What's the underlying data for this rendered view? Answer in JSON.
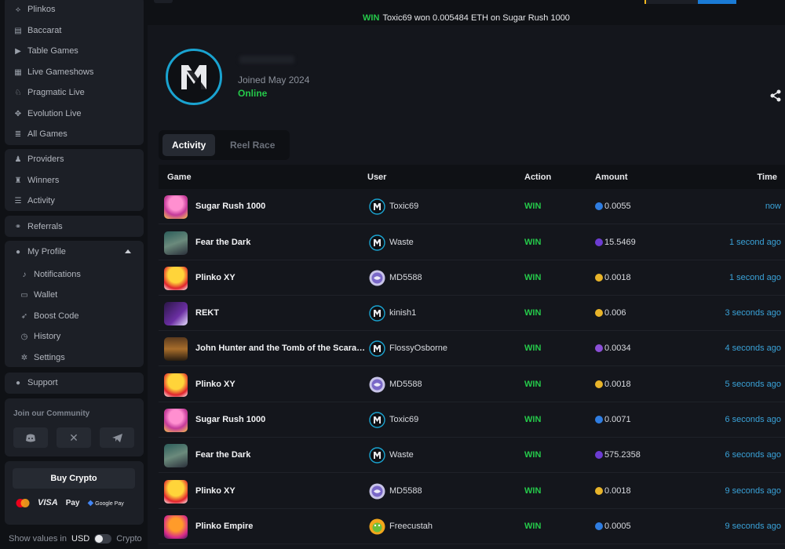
{
  "sidebar": {
    "group1": [
      {
        "label": "Plinkos",
        "icon": "plinko-icon"
      },
      {
        "label": "Baccarat",
        "icon": "cards-icon"
      },
      {
        "label": "Table Games",
        "icon": "table-icon"
      },
      {
        "label": "Live Gameshows",
        "icon": "gift-icon"
      },
      {
        "label": "Pragmatic Live",
        "icon": "dealer-icon"
      },
      {
        "label": "Evolution Live",
        "icon": "gamepad-icon"
      },
      {
        "label": "All Games",
        "icon": "stack-icon"
      }
    ],
    "group2": [
      {
        "label": "Providers",
        "icon": "providers-icon"
      },
      {
        "label": "Winners",
        "icon": "trophy-icon"
      },
      {
        "label": "Activity",
        "icon": "list-icon"
      }
    ],
    "referrals": "Referrals",
    "profile": {
      "label": "My Profile",
      "items": [
        {
          "label": "Notifications",
          "icon": "bell-icon"
        },
        {
          "label": "Wallet",
          "icon": "wallet-icon"
        },
        {
          "label": "Boost Code",
          "icon": "rocket-icon"
        },
        {
          "label": "History",
          "icon": "history-icon"
        },
        {
          "label": "Settings",
          "icon": "gear-icon"
        }
      ]
    },
    "support": "Support",
    "community_title": "Join our Community",
    "buy_crypto": "Buy Crypto",
    "payments": {
      "visa": "VISA",
      "apple_pay": "Pay",
      "google_pay": "Google Pay"
    },
    "show_values": {
      "label": "Show values in",
      "currency": "USD",
      "alt": "Crypto"
    }
  },
  "ticker": {
    "win": "WIN",
    "text": "Toxic69 won 0.005484 ETH on Sugar Rush 1000"
  },
  "profile": {
    "joined": "Joined May 2024",
    "status": "Online"
  },
  "tabs": {
    "active": "Activity",
    "inactive": "Reel Race"
  },
  "table": {
    "headers": {
      "game": "Game",
      "user": "User",
      "action": "Action",
      "amount": "Amount",
      "time": "Time"
    },
    "rows": [
      {
        "game": "Sugar Rush 1000",
        "thumb": "sugar",
        "user": "Toxic69",
        "avatar": "mx",
        "action": "WIN",
        "coin": "eth",
        "amount": "0.0055",
        "time": "now"
      },
      {
        "game": "Fear the Dark",
        "thumb": "fear",
        "user": "Waste",
        "avatar": "mx",
        "action": "WIN",
        "coin": "shib",
        "amount": "15.5469",
        "time": "1 second ago"
      },
      {
        "game": "Plinko XY",
        "thumb": "plinko",
        "user": "MD5588",
        "avatar": "purple",
        "action": "WIN",
        "coin": "gold",
        "amount": "0.0018",
        "time": "1 second ago"
      },
      {
        "game": "REKT",
        "thumb": "rekt",
        "user": "kinish1",
        "avatar": "mx",
        "action": "WIN",
        "coin": "gold",
        "amount": "0.006",
        "time": "3 seconds ago"
      },
      {
        "game": "John Hunter and the Tomb of the Scarab Queen",
        "thumb": "john",
        "user": "FlossyOsborne",
        "avatar": "mx",
        "action": "WIN",
        "coin": "purple",
        "amount": "0.0034",
        "time": "4 seconds ago"
      },
      {
        "game": "Plinko XY",
        "thumb": "plinko",
        "user": "MD5588",
        "avatar": "purple",
        "action": "WIN",
        "coin": "gold",
        "amount": "0.0018",
        "time": "5 seconds ago"
      },
      {
        "game": "Sugar Rush 1000",
        "thumb": "sugar",
        "user": "Toxic69",
        "avatar": "mx",
        "action": "WIN",
        "coin": "eth",
        "amount": "0.0071",
        "time": "6 seconds ago"
      },
      {
        "game": "Fear the Dark",
        "thumb": "fear",
        "user": "Waste",
        "avatar": "mx",
        "action": "WIN",
        "coin": "shib",
        "amount": "575.2358",
        "time": "6 seconds ago"
      },
      {
        "game": "Plinko XY",
        "thumb": "plinko",
        "user": "MD5588",
        "avatar": "purple",
        "action": "WIN",
        "coin": "gold",
        "amount": "0.0018",
        "time": "9 seconds ago"
      },
      {
        "game": "Plinko Empire",
        "thumb": "empire",
        "user": "Freecustah",
        "avatar": "frog",
        "action": "WIN",
        "coin": "eth",
        "amount": "0.0005",
        "time": "9 seconds ago"
      }
    ]
  },
  "colors": {
    "win": "#25c94a",
    "time": "#3aa2d8",
    "accent": "#1aa3d0"
  }
}
